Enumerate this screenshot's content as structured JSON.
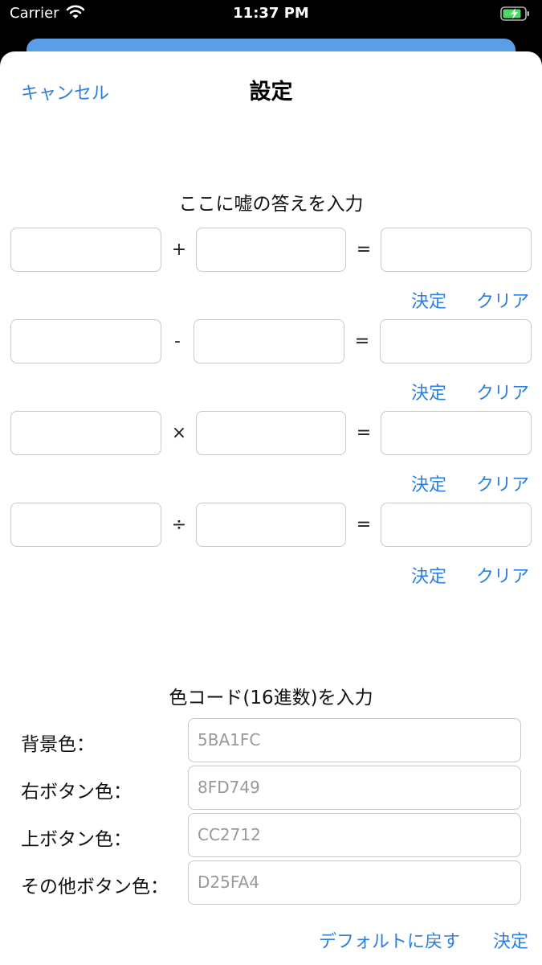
{
  "status_bar": {
    "carrier": "Carrier",
    "time": "11:37 PM"
  },
  "header": {
    "cancel_label": "キャンセル",
    "title": "設定"
  },
  "fake_answers": {
    "section_title": "ここに嘘の答えを入力",
    "rows": [
      {
        "operator": "+",
        "equals": "=",
        "confirm_label": "決定",
        "clear_label": "クリア"
      },
      {
        "operator": "-",
        "equals": "=",
        "confirm_label": "決定",
        "clear_label": "クリア"
      },
      {
        "operator": "×",
        "equals": "=",
        "confirm_label": "決定",
        "clear_label": "クリア"
      },
      {
        "operator": "÷",
        "equals": "=",
        "confirm_label": "決定",
        "clear_label": "クリア"
      }
    ]
  },
  "color_codes": {
    "section_title": "色コード(16進数)を入力",
    "fields": [
      {
        "label": "背景色：",
        "placeholder": "5BA1FC"
      },
      {
        "label": "右ボタン色：",
        "placeholder": "8FD749"
      },
      {
        "label": "上ボタン色：",
        "placeholder": "CC2712"
      },
      {
        "label": "その他ボタン色：",
        "placeholder": "D25FA4"
      }
    ],
    "reset_label": "デフォルトに戻す",
    "confirm_label": "決定"
  },
  "colors": {
    "accent": "#2D7FDB",
    "field_border": "#C7C7CC",
    "back_card": "#5B9EE8",
    "battery": "#4CD964"
  }
}
